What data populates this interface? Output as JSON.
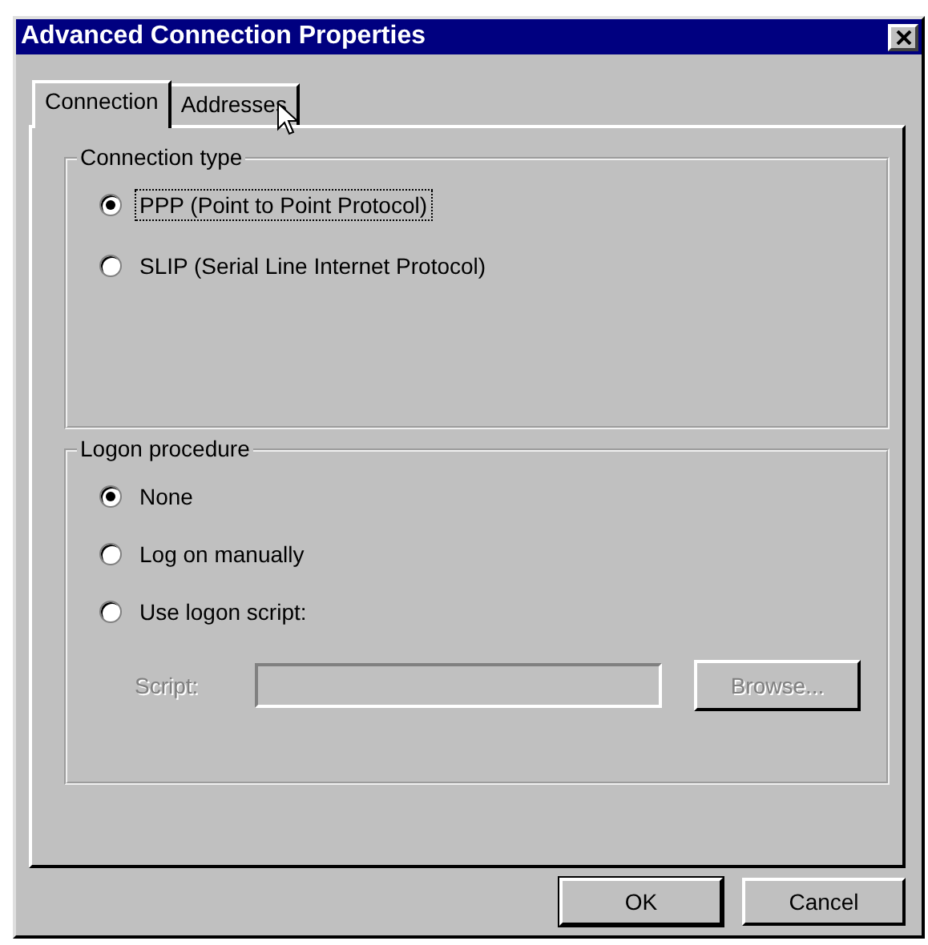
{
  "window": {
    "title": "Advanced Connection Properties"
  },
  "tabs": [
    {
      "label": "Connection",
      "selected": true
    },
    {
      "label": "Addresses",
      "selected": false
    }
  ],
  "groups": [
    {
      "title": "Connection type",
      "options": [
        {
          "label": "PPP (Point to Point Protocol)",
          "selected": true,
          "focused": true
        },
        {
          "label": "SLIP (Serial Line Internet Protocol)",
          "selected": false,
          "focused": false
        }
      ]
    },
    {
      "title": "Logon procedure",
      "options": [
        {
          "label": "None",
          "selected": true,
          "focused": false
        },
        {
          "label": "Log on manually",
          "selected": false,
          "focused": false
        },
        {
          "label": "Use logon script:",
          "selected": false,
          "focused": false
        }
      ],
      "script": {
        "label": "Script:",
        "disabled": true,
        "browse": "Browse..."
      }
    }
  ],
  "buttons": [
    {
      "label": "OK",
      "default": true
    },
    {
      "label": "Cancel",
      "default": false
    }
  ]
}
